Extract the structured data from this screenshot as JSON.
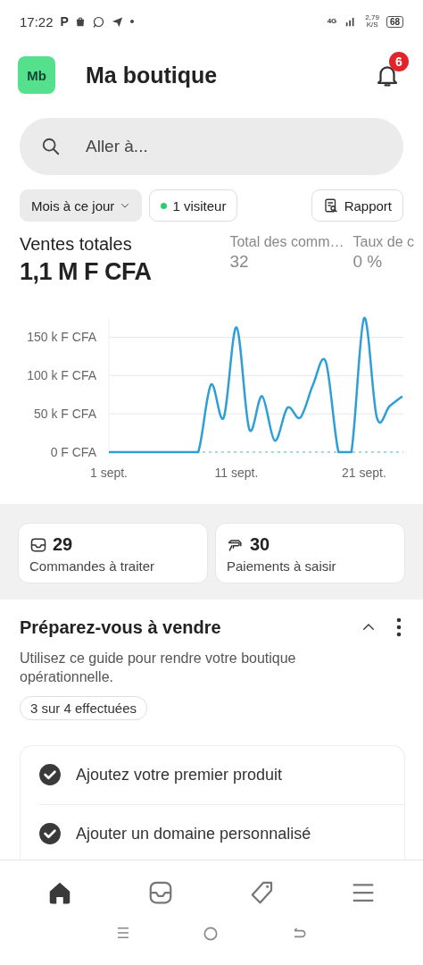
{
  "status_bar": {
    "time": "17:22",
    "app_icons": [
      "P"
    ],
    "network": "4G",
    "speed": "2,79",
    "speed_unit": "K/S",
    "battery": "68"
  },
  "header": {
    "avatar": "Mb",
    "title": "Ma boutique",
    "notifications": "6"
  },
  "search": {
    "placeholder": "Aller à..."
  },
  "filters": {
    "period": "Mois à ce jour",
    "visitors": "1 visiteur",
    "report": "Rapport"
  },
  "stats": [
    {
      "label": "Ventes totales",
      "value": "1,1 M F CFA",
      "kind": "main"
    },
    {
      "label": "Total des comm…",
      "value": "32",
      "kind": "minor"
    },
    {
      "label": "Taux de c",
      "value": "0 %",
      "kind": "minor"
    }
  ],
  "chart_data": {
    "type": "line",
    "categories": [
      "1 sept.",
      null,
      null,
      null,
      null,
      null,
      null,
      null,
      null,
      null,
      "11 sept.",
      null,
      null,
      null,
      null,
      null,
      null,
      null,
      null,
      null,
      "21 sept.",
      null,
      null,
      null
    ],
    "yticks": [
      {
        "value": 0,
        "label": "0 F CFA"
      },
      {
        "value": 50000,
        "label": "50 k F CFA"
      },
      {
        "value": 100000,
        "label": "100 k F CFA"
      },
      {
        "value": 150000,
        "label": "150 k F CFA"
      }
    ],
    "grid": true,
    "ylim": [
      0,
      175000
    ],
    "series": [
      {
        "color": "#2d9fd6",
        "values": [
          0,
          0,
          0,
          0,
          0,
          0,
          0,
          0,
          88000,
          45000,
          163000,
          30000,
          73000,
          15000,
          58000,
          45000,
          88000,
          118000,
          0,
          0,
          175000,
          45000,
          60000,
          73000
        ]
      }
    ]
  },
  "tasks": [
    {
      "kind": "orders",
      "count": "29",
      "label": "Commandes à traiter"
    },
    {
      "kind": "payments",
      "count": "30",
      "label": "Paiements à saisir"
    }
  ],
  "guide": {
    "title": "Préparez-vous à vendre",
    "expanded": true,
    "description": "Utilisez ce guide pour rendre votre boutique opérationnelle.",
    "progress": "3 sur 4 effectuées",
    "steps": [
      {
        "label": "Ajoutez votre premier produit",
        "checked": true
      },
      {
        "label": "Ajouter un domaine personnalisé",
        "checked": true
      }
    ]
  },
  "bottom_nav": [
    {
      "kind": "home",
      "selected": true
    },
    {
      "kind": "orders",
      "selected": false
    },
    {
      "kind": "products",
      "selected": false
    },
    {
      "kind": "menu",
      "selected": false
    }
  ]
}
